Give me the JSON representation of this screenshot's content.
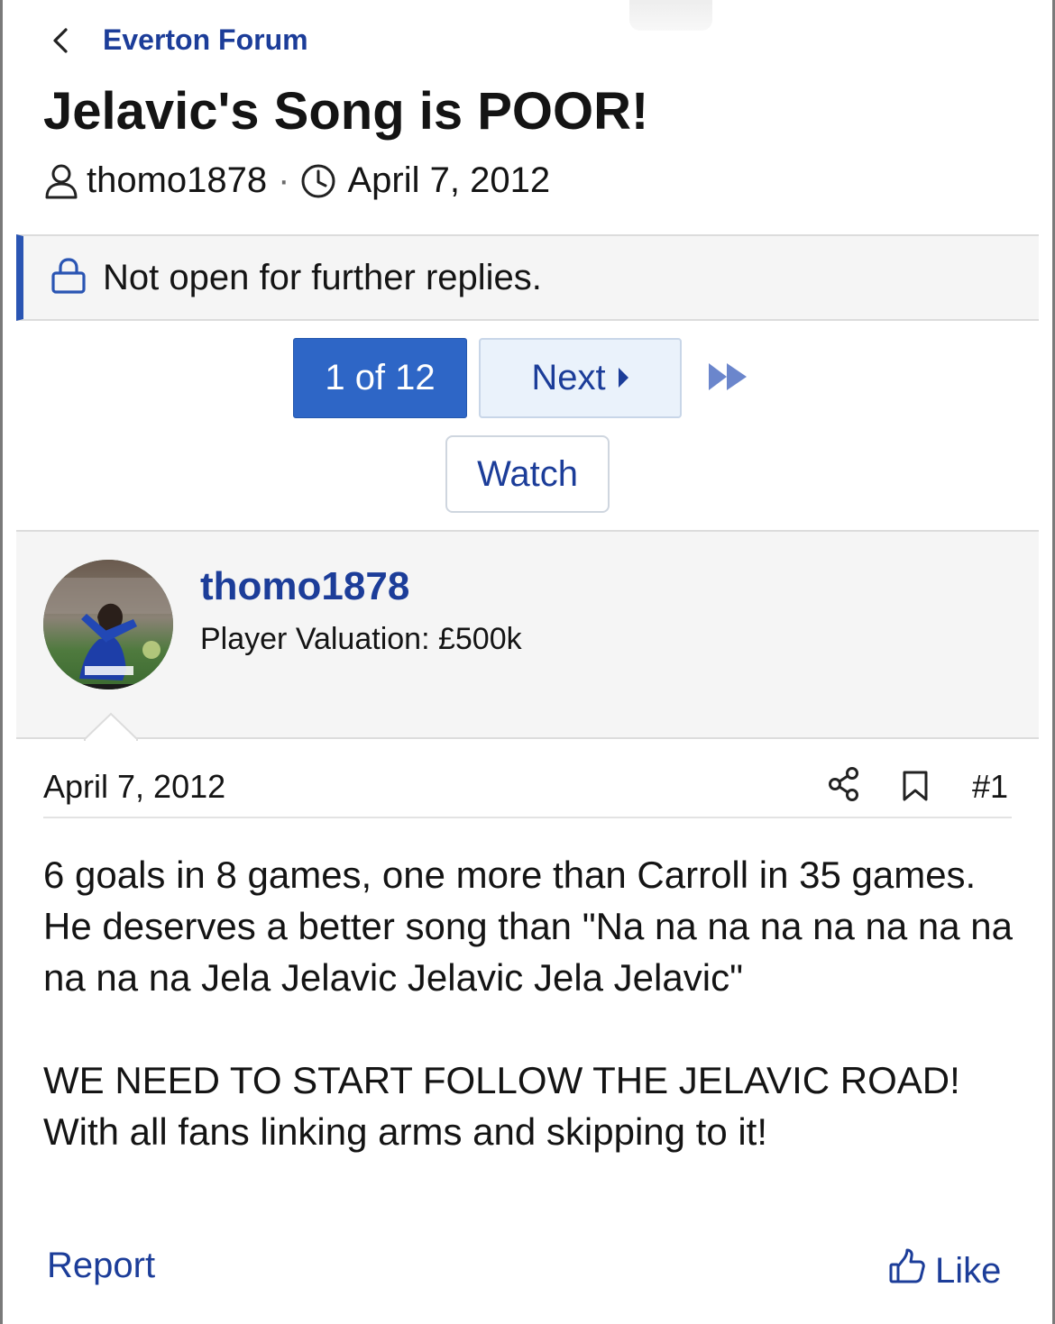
{
  "breadcrumb": {
    "label": "Everton Forum"
  },
  "thread": {
    "title": "Jelavic's Song is POOR!",
    "author": "thomo1878",
    "separator": "·",
    "date": "April 7, 2012"
  },
  "notice": {
    "text": "Not open for further replies."
  },
  "pagination": {
    "current": "1 of 12",
    "next": "Next"
  },
  "actions": {
    "watch": "Watch",
    "report": "Report",
    "like": "Like"
  },
  "post": {
    "author": "thomo1878",
    "user_title": "Player Valuation: £500k",
    "date": "April 7, 2012",
    "number": "#1",
    "body": [
      "6 goals in 8 games, one more than Carroll in 35 games. He deserves a better song than \"Na na na na na na na na na na na Jela Jelavic Jelavic Jela Jelavic\"",
      "WE NEED TO START FOLLOW THE JELAVIC ROAD! With all fans linking arms and skipping to it!"
    ]
  },
  "colors": {
    "link": "#1c3d99",
    "accent": "#2e66c6",
    "notice_bar": "#2a55b3"
  },
  "icons": [
    "chevron-left-icon",
    "user-icon",
    "clock-icon",
    "lock-icon",
    "caret-right-icon",
    "double-chevron-right-icon",
    "share-icon",
    "bookmark-icon",
    "thumbs-up-icon"
  ]
}
